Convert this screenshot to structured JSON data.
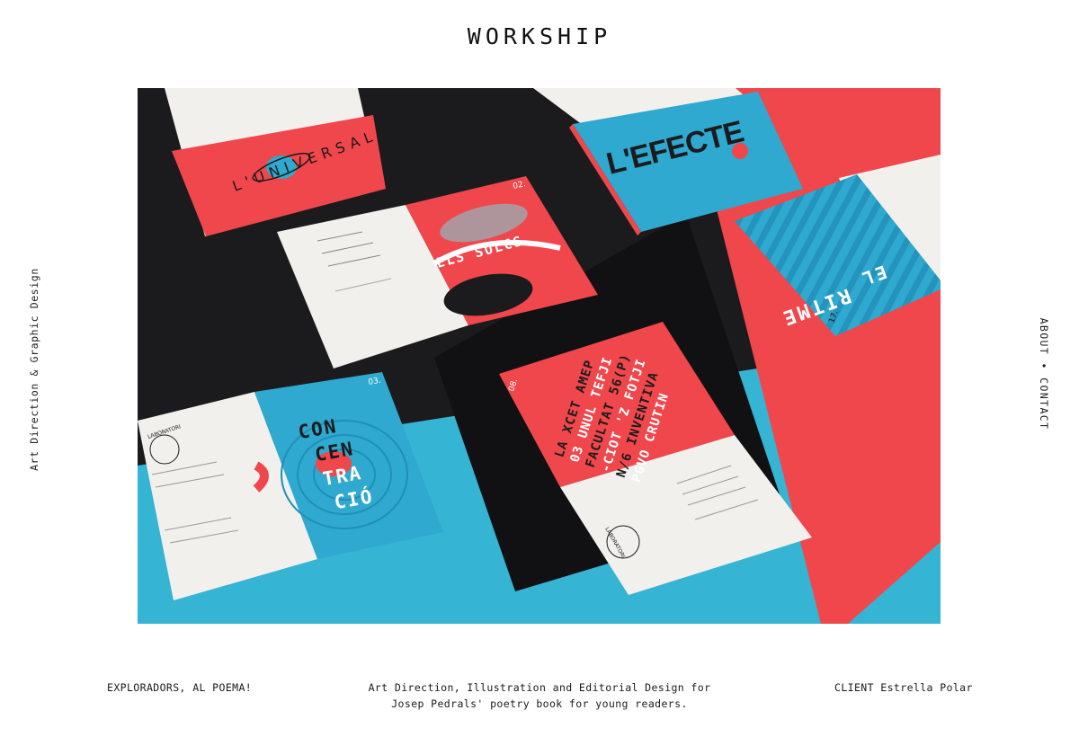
{
  "site": {
    "title": "WORKSHIP"
  },
  "sidebar_left": {
    "tagline": "Art Direction & Graphic Design"
  },
  "sidebar_right": {
    "about": "ABOUT",
    "separator": "•",
    "contact": "CONTACT"
  },
  "hero": {
    "spreads": {
      "universal": {
        "number": "",
        "headline": "L'UNIVERSAL"
      },
      "solcs": {
        "number": "02.",
        "headline": "ELS SOLCS"
      },
      "efecte": {
        "number": "",
        "headline": "L'EFECTE"
      },
      "ritme": {
        "number": "17.",
        "line1": "EL",
        "line2": "RITME"
      },
      "concentracio": {
        "number": "03.",
        "lines": [
          "CON",
          "CEN",
          "TRA",
          "CIÓ"
        ],
        "logo": "LABORATORI"
      },
      "vertical": {
        "number": "08.",
        "lines": [
          "LA XCET AMEP",
          "03 UNUL TEFJI",
          "FACULTAT 56(P)",
          "-CIOT 'Z FOTJI",
          "N/6 INVENTIVA",
          "PGVO CRUTIN"
        ],
        "logo": "LABORATORI"
      }
    }
  },
  "footer": {
    "project": "EXPLORADORS, AL POEMA!",
    "description_line1": "Art Direction, Illustration and Editorial Design for",
    "description_line2": "Josep Pedrals' poetry book for young readers.",
    "client_label": "CLIENT",
    "client_name": "Estrella Polar"
  },
  "colors": {
    "red": "#f0474c",
    "blue": "#2fa9cf",
    "black": "#1b1b1d",
    "paper": "#f2f0ec"
  }
}
